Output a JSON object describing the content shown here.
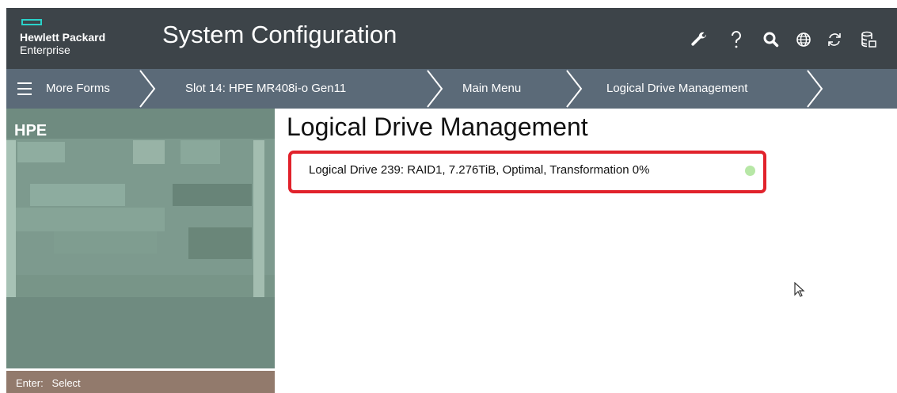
{
  "header": {
    "logo_line1": "Hewlett Packard",
    "logo_line2": "Enterprise",
    "title": "System Configuration",
    "icons": [
      "wrench-icon",
      "help-icon",
      "search-icon",
      "globe-icon",
      "refresh-icon",
      "database-icon"
    ]
  },
  "breadcrumb": {
    "items": [
      "More Forms",
      "Slot 14: HPE MR408i-o Gen11",
      "Main Menu",
      "Logical Drive Management"
    ]
  },
  "left_panel": {
    "label": "HPE"
  },
  "footer": {
    "key": "Enter:",
    "action": "Select"
  },
  "main": {
    "heading": "Logical Drive Management",
    "drives": [
      {
        "label": "Logical Drive 239: RAID1, 7.276TiB, Optimal, Transformation 0%"
      }
    ]
  },
  "colors": {
    "header_bg": "#3d4449",
    "breadcrumb_bg": "#5b6a78",
    "panel_bg": "#6f8b80",
    "footer_bg": "#927a6c",
    "highlight": "#e1222b",
    "logo_accent": "#2ad2c9"
  }
}
